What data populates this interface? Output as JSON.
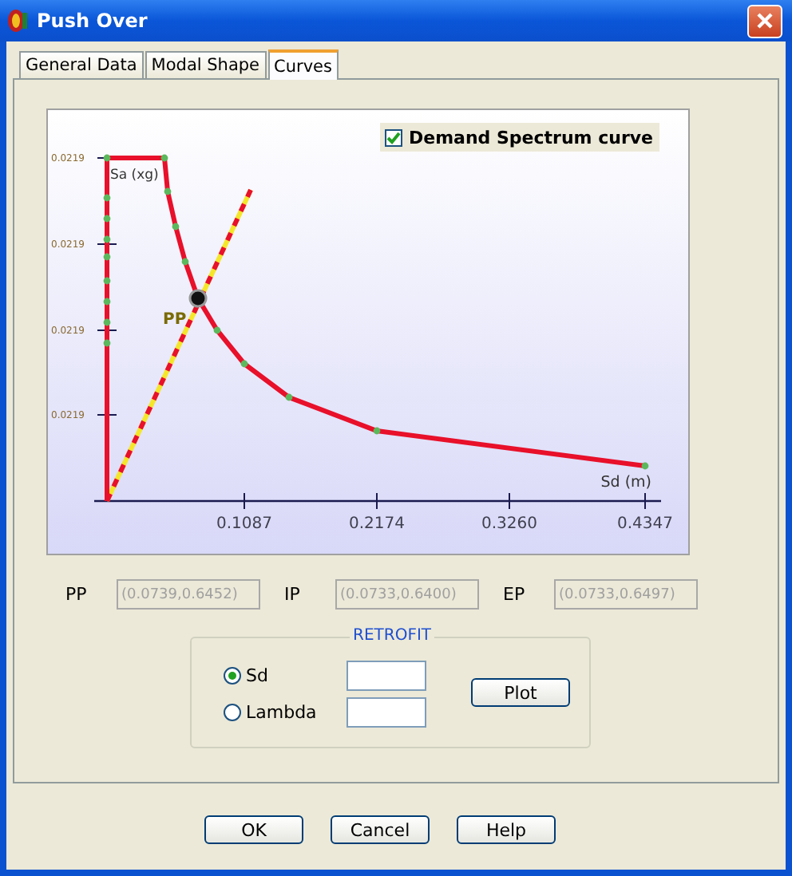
{
  "window": {
    "title": "Push Over"
  },
  "tabs": [
    {
      "label": "General Data",
      "selected": false
    },
    {
      "label": "Modal Shape",
      "selected": false
    },
    {
      "label": "Curves",
      "selected": true
    }
  ],
  "chart": {
    "legend_label": "Demand Spectrum curve",
    "legend_checked": true,
    "y_tick_labels": [
      "0.0219",
      "0.0219",
      "0.0219",
      "0.0219"
    ],
    "y_axis_title": "Sa (xg)",
    "x_tick_labels": [
      "0.1087",
      "0.2174",
      "0.3260",
      "0.4347"
    ],
    "x_axis_title": "Sd (m)",
    "point_label": "PP"
  },
  "points": [
    {
      "label": "PP",
      "value": "(0.0739,0.6452)"
    },
    {
      "label": "IP",
      "value": "(0.0733,0.6400)"
    },
    {
      "label": "EP",
      "value": "(0.0733,0.6497)"
    }
  ],
  "retrofit": {
    "title": "RETROFIT",
    "options": [
      {
        "label": "Sd",
        "selected": true
      },
      {
        "label": "Lambda",
        "selected": false
      }
    ],
    "button": "Plot"
  },
  "buttons": [
    "OK",
    "Cancel",
    "Help"
  ]
}
